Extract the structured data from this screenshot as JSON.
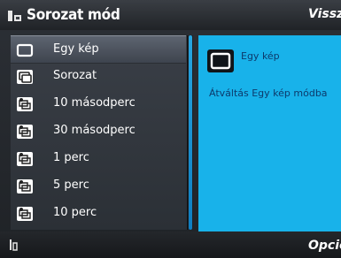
{
  "header": {
    "title": "Sorozat mód",
    "back_label": "Vissz"
  },
  "list": {
    "items": [
      {
        "label": "Egy kép",
        "icon": "single-frame-icon",
        "selected": true
      },
      {
        "label": "Sorozat",
        "icon": "burst-icon",
        "selected": false
      },
      {
        "label": "10 másodperc",
        "icon": "timed-burst-10s-icon",
        "selected": false
      },
      {
        "label": "30 másodperc",
        "icon": "timed-burst-30s-icon",
        "selected": false
      },
      {
        "label": "1 perc",
        "icon": "timed-burst-1m-icon",
        "selected": false
      },
      {
        "label": "5 perc",
        "icon": "timed-burst-5m-icon",
        "selected": false
      },
      {
        "label": "10 perc",
        "icon": "timed-burst-10m-icon",
        "selected": false
      }
    ]
  },
  "preview": {
    "title": "Egy kép",
    "description": "Átváltás Egy kép módba"
  },
  "softkeys": {
    "right_label": "Opció"
  },
  "colors": {
    "accent": "#18b2ea",
    "preview_text": "#0d3a6b",
    "selected_row": "#4a505a"
  }
}
